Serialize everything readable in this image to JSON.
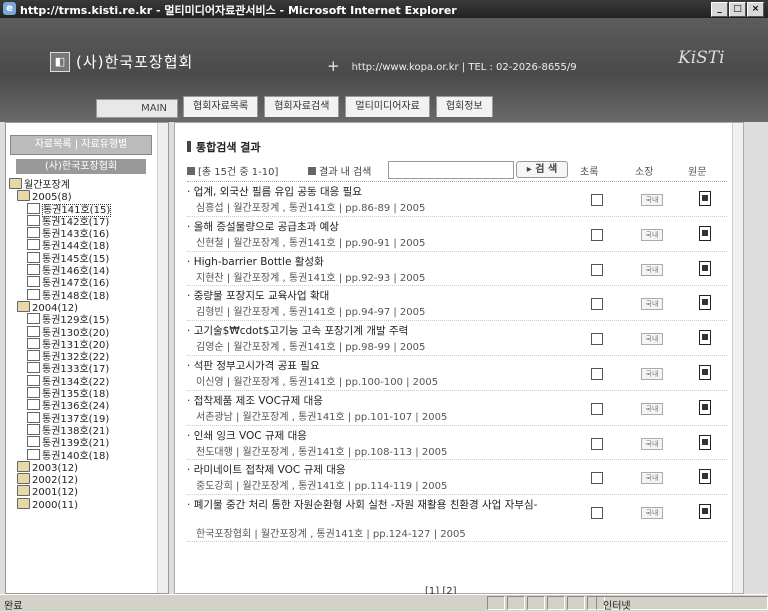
{
  "window": {
    "title": "http://trms.kisti.re.kr - 멀티미디어자료관서비스 - Microsoft Internet Explorer",
    "minimize": "_",
    "maximize": "□",
    "close": "×"
  },
  "header": {
    "org_name": "(사)한국포장협회",
    "contact": "http://www.kopa.or.kr | TEL : 02-2026-8655/9",
    "logo": "KiSTi"
  },
  "nav": {
    "main": "MAIN",
    "tabs": [
      "협회자료목록",
      "협회자료검색",
      "멀티미디어자료",
      "협회정보"
    ]
  },
  "sidebar": {
    "tabs_label": "자료목록 | 자료유형별",
    "org": "(사)한국포장협회",
    "tree": [
      {
        "label": "월간포장계",
        "level": 0,
        "type": "folder"
      },
      {
        "label": "2005(8)",
        "level": 1,
        "type": "year"
      },
      {
        "label": "통권141호(15)",
        "level": 2,
        "type": "doc",
        "selected": true
      },
      {
        "label": "통권142호(17)",
        "level": 2,
        "type": "doc"
      },
      {
        "label": "통권143호(16)",
        "level": 2,
        "type": "doc"
      },
      {
        "label": "통권144호(18)",
        "level": 2,
        "type": "doc"
      },
      {
        "label": "통권145호(15)",
        "level": 2,
        "type": "doc"
      },
      {
        "label": "통권146호(14)",
        "level": 2,
        "type": "doc"
      },
      {
        "label": "통권147호(16)",
        "level": 2,
        "type": "doc"
      },
      {
        "label": "통권148호(18)",
        "level": 2,
        "type": "doc"
      },
      {
        "label": "2004(12)",
        "level": 1,
        "type": "year"
      },
      {
        "label": "통권129호(15)",
        "level": 2,
        "type": "doc"
      },
      {
        "label": "통권130호(20)",
        "level": 2,
        "type": "doc"
      },
      {
        "label": "통권131호(20)",
        "level": 2,
        "type": "doc"
      },
      {
        "label": "통권132호(22)",
        "level": 2,
        "type": "doc"
      },
      {
        "label": "통권133호(17)",
        "level": 2,
        "type": "doc"
      },
      {
        "label": "통권134호(22)",
        "level": 2,
        "type": "doc"
      },
      {
        "label": "통권135호(18)",
        "level": 2,
        "type": "doc"
      },
      {
        "label": "통권136호(24)",
        "level": 2,
        "type": "doc"
      },
      {
        "label": "통권137호(19)",
        "level": 2,
        "type": "doc"
      },
      {
        "label": "통권138호(21)",
        "level": 2,
        "type": "doc"
      },
      {
        "label": "통권139호(21)",
        "level": 2,
        "type": "doc"
      },
      {
        "label": "통권140호(18)",
        "level": 2,
        "type": "doc"
      },
      {
        "label": "2003(12)",
        "level": 1,
        "type": "year"
      },
      {
        "label": "2002(12)",
        "level": 1,
        "type": "year"
      },
      {
        "label": "2001(12)",
        "level": 1,
        "type": "year"
      },
      {
        "label": "2000(11)",
        "level": 1,
        "type": "year"
      }
    ]
  },
  "results": {
    "title": "통합검색 결과",
    "count_label": "[총 15건 중 1-10]",
    "within_label": "결과 내 검색",
    "search_value": "",
    "search_button": "▸ 검 색",
    "columns": [
      "초록",
      "소장",
      "원문"
    ],
    "items": [
      {
        "title": "업계, 외국산 필름 유입 공동 대응 필요",
        "meta": "심흥섭 | 월간포장계 , 통권141호 | pp.86-89 | 2005",
        "loc": "국내"
      },
      {
        "title": "올해 증설물량으로 공급초과 예상",
        "meta": "신현철 | 월간포장계 , 통권141호 | pp.90-91 | 2005",
        "loc": "국내"
      },
      {
        "title": "High-barrier Bottle 활성화",
        "meta": "지현찬 | 월간포장계 , 통권141호 | pp.92-93 | 2005",
        "loc": "국내"
      },
      {
        "title": "중량물 포장지도 교육사업 확대",
        "meta": "김형빈 | 월간포장계 , 통권141호 | pp.94-97 | 2005",
        "loc": "국내"
      },
      {
        "title": "고기술$₩cdot$고기능 고속 포장기계 개발 주력",
        "meta": "김영순 | 월간포장계 , 통권141호 | pp.98-99 | 2005",
        "loc": "국내"
      },
      {
        "title": "석판 정부고시가격 공표 필요",
        "meta": "이신영 | 월간포장계 , 통권141호 | pp.100-100 | 2005",
        "loc": "국내"
      },
      {
        "title": "접착제품 제조 VOC규제 대응",
        "meta": "서촌광남 | 월간포장계 , 통권141호 | pp.101-107 | 2005",
        "loc": "국내"
      },
      {
        "title": "인쇄 잉크 VOC 규제 대응",
        "meta": "천도대행 | 월간포장계 , 통권141호 | pp.108-113 | 2005",
        "loc": "국내"
      },
      {
        "title": "라미네이트 접착제 VOC 규제 대응",
        "meta": "중도강희 | 월간포장계 , 통권141호 | pp.114-119 | 2005",
        "loc": "국내"
      },
      {
        "title": "폐기물 중간 처리 통한 자원순환형 사회 실천 -자원 재활용 친환경 사업 자부심-",
        "meta": "한국포장협회 | 월간포장계 , 통권141호 | pp.124-127 | 2005",
        "loc": "국내"
      }
    ],
    "pager": "[1] [2]"
  },
  "status": {
    "text": "완료",
    "zone": "인터넷"
  }
}
